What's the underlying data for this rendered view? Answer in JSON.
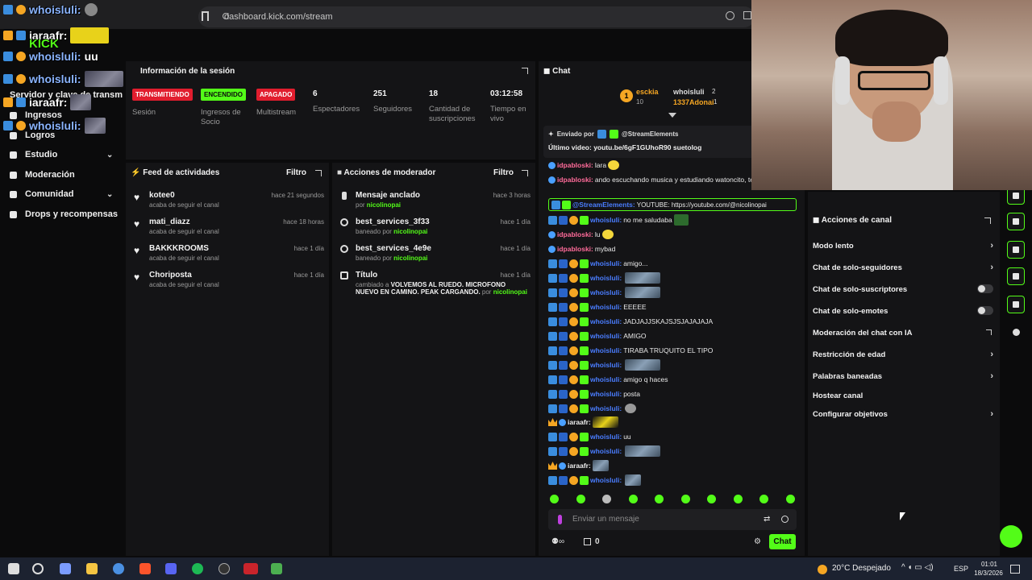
{
  "browser": {
    "url": "dashboard.kick.com/stream"
  },
  "overlay": {
    "lines": [
      {
        "user": "whoisluli:",
        "msg": ""
      },
      {
        "user": "iaraafr:",
        "msg": ""
      },
      {
        "user": "whoisluli:",
        "msg": "uu"
      },
      {
        "user": "whoisluli:",
        "msg": ""
      },
      {
        "user": "iaraafr:",
        "msg": ""
      },
      {
        "user": "whoisluli:",
        "msg": ""
      }
    ],
    "logo": "KICK"
  },
  "nav": {
    "items": [
      {
        "label": "Servidor y clave de transm"
      },
      {
        "label": "Ingresos"
      },
      {
        "label": "Logros"
      },
      {
        "label": "Estudio",
        "chevron": "⌄"
      },
      {
        "label": "Moderación"
      },
      {
        "label": "Comunidad",
        "chevron": "⌄"
      },
      {
        "label": "Drops y recompensas"
      }
    ]
  },
  "session": {
    "title": "Información de la sesión",
    "badges": [
      {
        "text": "TRANSMITIENDO",
        "label": "Sesión",
        "color": "#e11d2e"
      },
      {
        "text": "ENCENDIDO",
        "label": "Ingresos de Socio",
        "color": "#53fc18"
      },
      {
        "text": "APAGADO",
        "label": "Multistream",
        "color": "#e11d2e"
      }
    ],
    "stats": [
      {
        "value": "6",
        "label": "Espectadores"
      },
      {
        "value": "251",
        "label": "Seguidores"
      },
      {
        "value": "18",
        "label": "Cantidad de suscripciones"
      },
      {
        "value": "03:12:58",
        "label": "Tiempo en vivo"
      }
    ]
  },
  "feed": {
    "title": "Feed de actividades",
    "filter": "Filtro",
    "items": [
      {
        "name": "kotee0",
        "sub": "acaba de seguir el canal",
        "time": "hace 21 segundos"
      },
      {
        "name": "mati_diazz",
        "sub": "acaba de seguir el canal",
        "time": "hace 18 horas"
      },
      {
        "name": "BAKKKROOMS",
        "sub": "acaba de seguir el canal",
        "time": "hace 1 día"
      },
      {
        "name": "Choriposta",
        "sub": "acaba de seguir el canal",
        "time": "hace 1 día"
      }
    ]
  },
  "modactions": {
    "title": "Acciones de moderador",
    "filter": "Filtro",
    "items": [
      {
        "name": "Mensaje anclado",
        "pre": "por ",
        "by": "nicolinopai",
        "post": "",
        "time": "hace 3 horas"
      },
      {
        "name": "best_services_3f33",
        "pre": "baneado por ",
        "by": "nicolinopai",
        "post": "",
        "time": "hace 1 día"
      },
      {
        "name": "best_services_4e9e",
        "pre": "baneado por ",
        "by": "nicolinopai",
        "post": "",
        "time": "hace 1 día"
      },
      {
        "name": "Título",
        "pre": "cambiado a ",
        "bold": "VOLVEMOS AL RUEDO. MICROFONO NUEVO EN CAMINO. PEAK CARGANDO.",
        "post": " por ",
        "by": "nicolinopai",
        "time": "hace 1 día"
      }
    ]
  },
  "chat": {
    "title": "Chat",
    "top": [
      {
        "rank": "1",
        "name": "esckia",
        "sub": "10"
      },
      {
        "name": "whoisluli",
        "count": "2"
      },
      {
        "name": "1337Adonai",
        "count": "1"
      }
    ],
    "pinned": {
      "sent_by": "Enviado por",
      "bot": "@StreamElements",
      "text": "Último video: youtu.be/6gF1GUhoR90 suetolog"
    },
    "messages": [
      {
        "user": "idpabloski:",
        "text": "lara",
        "color": "pink"
      },
      {
        "user": "idpabloski:",
        "text": "ando escuchando musica y estudiando watoncito, te",
        "color": "pink"
      },
      {
        "user": "@StreamElements:",
        "text": "YOUTUBE: https://youtube.com/@nicolinopai",
        "color": "blue"
      },
      {
        "user": "whoisluli:",
        "text": "no me saludaba",
        "color": "blue"
      },
      {
        "user": "idpabloski:",
        "text": "lu",
        "color": "pink"
      },
      {
        "user": "idpabloski:",
        "text": "mybad",
        "color": "pink"
      },
      {
        "user": "whoisluli:",
        "text": "amigo...",
        "color": "blue"
      },
      {
        "user": "whoisluli:",
        "text": "",
        "color": "blue"
      },
      {
        "user": "whoisluli:",
        "text": "",
        "color": "blue"
      },
      {
        "user": "whoisluli:",
        "text": "EEEEE",
        "color": "blue"
      },
      {
        "user": "whoisluli:",
        "text": "JADJAJJSKAJSJSJAJAJAJA",
        "color": "blue"
      },
      {
        "user": "whoisluli:",
        "text": "AMIGO",
        "color": "blue"
      },
      {
        "user": "whoisluli:",
        "text": "TIRABA TRUQUITO EL TIPO",
        "color": "blue"
      },
      {
        "user": "whoisluli:",
        "text": "",
        "color": "blue"
      },
      {
        "user": "whoisluli:",
        "text": "amigo q haces",
        "color": "blue"
      },
      {
        "user": "whoisluli:",
        "text": "posta",
        "color": "blue"
      },
      {
        "user": "whoisluli:",
        "text": "",
        "color": "blue"
      },
      {
        "user": "iaraafr:",
        "text": "",
        "color": "white"
      },
      {
        "user": "whoisluli:",
        "text": "uu",
        "color": "blue"
      },
      {
        "user": "whoisluli:",
        "text": "",
        "color": "blue"
      },
      {
        "user": "iaraafr:",
        "text": "",
        "color": "white"
      },
      {
        "user": "whoisluli:",
        "text": "",
        "color": "blue"
      }
    ],
    "input_placeholder": "Enviar un mensaje",
    "points": "0",
    "send_label": "Chat"
  },
  "channel_actions": {
    "title": "Acciones de canal",
    "items": [
      {
        "label": "Modo lento",
        "kind": "chevron"
      },
      {
        "label": "Chat de solo-seguidores",
        "kind": "chevron"
      },
      {
        "label": "Chat de solo-suscriptores",
        "kind": "toggle"
      },
      {
        "label": "Chat de solo-emotes",
        "kind": "toggle"
      },
      {
        "label": "Moderación del chat con IA",
        "kind": "external"
      },
      {
        "label": "Restricción de edad",
        "kind": "chevron"
      },
      {
        "label": "Palabras baneadas",
        "kind": "chevron"
      },
      {
        "label": "Hostear canal",
        "kind": "none"
      },
      {
        "label": "Configurar objetivos",
        "kind": "chevron"
      }
    ]
  },
  "taskbar": {
    "weather": "20°C Despejado",
    "lang": "ESP",
    "time": "01:01",
    "date": "18/3/2026"
  },
  "colors": {
    "accent": "#53fc18",
    "live_red": "#e11d2e",
    "username_blue": "#4a7dff",
    "username_pink": "#ff6b9a"
  }
}
